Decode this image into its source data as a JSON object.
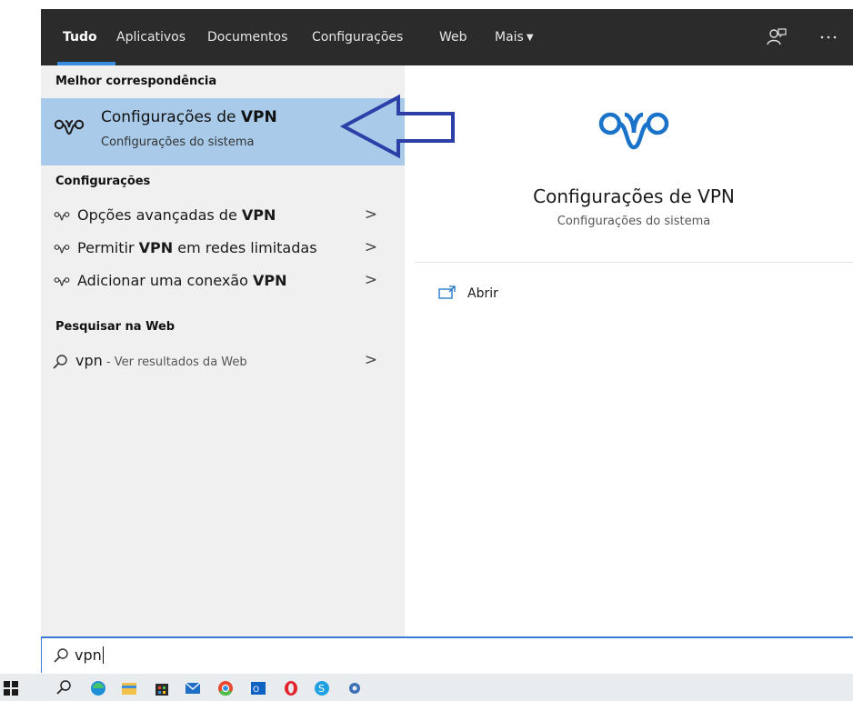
{
  "tabs": [
    {
      "label": "Tudo"
    },
    {
      "label": "Aplicativos"
    },
    {
      "label": "Documentos"
    },
    {
      "label": "Configurações"
    },
    {
      "label": "Web"
    },
    {
      "label": "Mais"
    }
  ],
  "toolbar": {
    "feedback_icon": "feedback-icon",
    "more_icon": "more-options-icon"
  },
  "best_match": {
    "header": "Melhor correspondência",
    "title_prefix": "Configurações de ",
    "title_bold": "VPN",
    "subtitle": "Configurações do sistema",
    "icon": "vpn-icon"
  },
  "settings_section": {
    "header": "Configurações",
    "items": [
      {
        "pre": "Opções avançadas de ",
        "bold": "VPN",
        "post": "",
        "chevron": ">"
      },
      {
        "pre": "Permitir ",
        "bold": "VPN",
        "post": " em redes limitadas",
        "chevron": ">"
      },
      {
        "pre": "Adicionar uma conexão ",
        "bold": "VPN",
        "post": "",
        "chevron": ">"
      }
    ]
  },
  "web_section": {
    "header": "Pesquisar na Web",
    "query": "vpn",
    "suffix": " - Ver resultados da Web",
    "chevron": ">"
  },
  "preview": {
    "title": "Configurações de VPN",
    "subtitle": "Configurações do sistema",
    "open_label": "Abrir"
  },
  "search": {
    "value": "vpn"
  },
  "colors": {
    "tabbar_bg": "#2b2b2b",
    "accent": "#3a8be0",
    "highlight": "#a9cbe9",
    "annotation_arrow": "#2f3fa8",
    "vpn_icon_blue": "#1a73c9"
  },
  "taskbar_icons": [
    "start-icon",
    "search-icon",
    "edge-icon",
    "file-explorer-icon",
    "store-icon",
    "mail-icon",
    "chrome-icon",
    "outlook-icon",
    "opera-icon",
    "skype-icon",
    "app-icon"
  ]
}
